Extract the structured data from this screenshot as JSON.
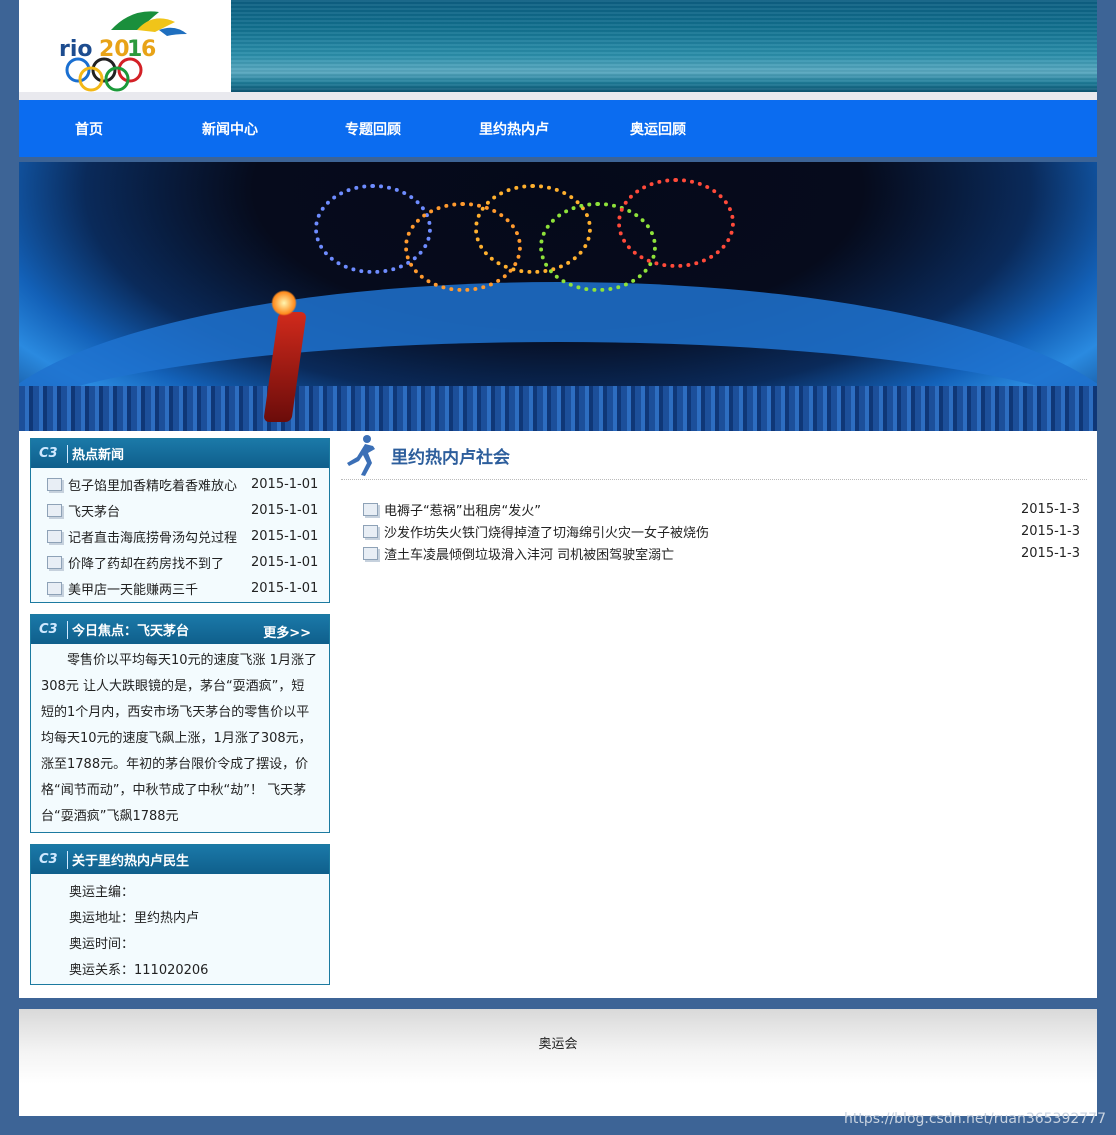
{
  "header": {
    "logo_alt": "rio 2016"
  },
  "nav": {
    "items": [
      "首页",
      "新闻中心",
      "专题回顾",
      "里约热内卢",
      "奥运回顾"
    ]
  },
  "hot_news": {
    "title": "热点新闻",
    "items": [
      {
        "title": "包子馅里加香精吃着香难放心",
        "date": "2015-1-01"
      },
      {
        "title": "飞天茅台",
        "date": "2015-1-01"
      },
      {
        "title": "记者直击海底捞骨汤勾兑过程",
        "date": "2015-1-01"
      },
      {
        "title": "价降了药却在药房找不到了",
        "date": "2015-1-01"
      },
      {
        "title": "美甲店一天能赚两三千",
        "date": "2015-1-01"
      }
    ]
  },
  "focus": {
    "title": "今日焦点：飞天茅台",
    "more": "更多>>",
    "text": "零售价以平均每天10元的速度飞涨 1月涨了308元 让人大跌眼镜的是，茅台“耍酒疯”，短短的1个月内，西安市场飞天茅台的零售价以平均每天10元的速度飞飙上涨，1月涨了308元，涨至1788元。年初的茅台限价令成了摆设，价格“闻节而动”，中秋节成了中秋“劫”！ 飞天茅台“耍酒疯”飞飙1788元"
  },
  "about": {
    "title": "关于里约热内卢民生",
    "lines": [
      "奥运主编：",
      "奥运地址：里约热内卢",
      "奥运时间：",
      "奥运关系：111020206"
    ]
  },
  "main": {
    "title": "里约热内卢社会",
    "items": [
      {
        "title": "电褥子“惹祸”出租房“发火”",
        "date": "2015-1-3"
      },
      {
        "title": "沙发作坊失火铁门烧得掉渣了切海绵引火灾一女子被烧伤",
        "date": "2015-1-3"
      },
      {
        "title": "渣土车凌晨倾倒垃圾滑入沣河 司机被困驾驶室溺亡",
        "date": "2015-1-3"
      }
    ]
  },
  "footer": {
    "text": "奥运会"
  },
  "watermark": "https://blog.csdn.net/ruan365392777"
}
